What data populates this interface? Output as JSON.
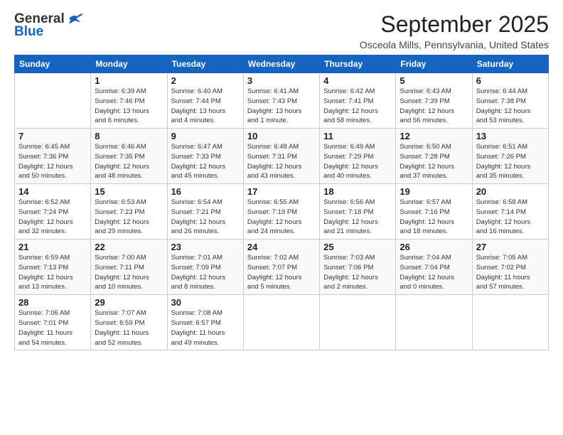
{
  "logo": {
    "line1": "General",
    "line2": "Blue"
  },
  "header": {
    "month": "September 2025",
    "location": "Osceola Mills, Pennsylvania, United States"
  },
  "weekdays": [
    "Sunday",
    "Monday",
    "Tuesday",
    "Wednesday",
    "Thursday",
    "Friday",
    "Saturday"
  ],
  "weeks": [
    [
      {
        "day": "",
        "info": ""
      },
      {
        "day": "1",
        "info": "Sunrise: 6:39 AM\nSunset: 7:46 PM\nDaylight: 13 hours\nand 6 minutes."
      },
      {
        "day": "2",
        "info": "Sunrise: 6:40 AM\nSunset: 7:44 PM\nDaylight: 13 hours\nand 4 minutes."
      },
      {
        "day": "3",
        "info": "Sunrise: 6:41 AM\nSunset: 7:43 PM\nDaylight: 13 hours\nand 1 minute."
      },
      {
        "day": "4",
        "info": "Sunrise: 6:42 AM\nSunset: 7:41 PM\nDaylight: 12 hours\nand 58 minutes."
      },
      {
        "day": "5",
        "info": "Sunrise: 6:43 AM\nSunset: 7:39 PM\nDaylight: 12 hours\nand 56 minutes."
      },
      {
        "day": "6",
        "info": "Sunrise: 6:44 AM\nSunset: 7:38 PM\nDaylight: 12 hours\nand 53 minutes."
      }
    ],
    [
      {
        "day": "7",
        "info": "Sunrise: 6:45 AM\nSunset: 7:36 PM\nDaylight: 12 hours\nand 50 minutes."
      },
      {
        "day": "8",
        "info": "Sunrise: 6:46 AM\nSunset: 7:35 PM\nDaylight: 12 hours\nand 48 minutes."
      },
      {
        "day": "9",
        "info": "Sunrise: 6:47 AM\nSunset: 7:33 PM\nDaylight: 12 hours\nand 45 minutes."
      },
      {
        "day": "10",
        "info": "Sunrise: 6:48 AM\nSunset: 7:31 PM\nDaylight: 12 hours\nand 43 minutes."
      },
      {
        "day": "11",
        "info": "Sunrise: 6:49 AM\nSunset: 7:29 PM\nDaylight: 12 hours\nand 40 minutes."
      },
      {
        "day": "12",
        "info": "Sunrise: 6:50 AM\nSunset: 7:28 PM\nDaylight: 12 hours\nand 37 minutes."
      },
      {
        "day": "13",
        "info": "Sunrise: 6:51 AM\nSunset: 7:26 PM\nDaylight: 12 hours\nand 35 minutes."
      }
    ],
    [
      {
        "day": "14",
        "info": "Sunrise: 6:52 AM\nSunset: 7:24 PM\nDaylight: 12 hours\nand 32 minutes."
      },
      {
        "day": "15",
        "info": "Sunrise: 6:53 AM\nSunset: 7:23 PM\nDaylight: 12 hours\nand 29 minutes."
      },
      {
        "day": "16",
        "info": "Sunrise: 6:54 AM\nSunset: 7:21 PM\nDaylight: 12 hours\nand 26 minutes."
      },
      {
        "day": "17",
        "info": "Sunrise: 6:55 AM\nSunset: 7:19 PM\nDaylight: 12 hours\nand 24 minutes."
      },
      {
        "day": "18",
        "info": "Sunrise: 6:56 AM\nSunset: 7:18 PM\nDaylight: 12 hours\nand 21 minutes."
      },
      {
        "day": "19",
        "info": "Sunrise: 6:57 AM\nSunset: 7:16 PM\nDaylight: 12 hours\nand 18 minutes."
      },
      {
        "day": "20",
        "info": "Sunrise: 6:58 AM\nSunset: 7:14 PM\nDaylight: 12 hours\nand 16 minutes."
      }
    ],
    [
      {
        "day": "21",
        "info": "Sunrise: 6:59 AM\nSunset: 7:13 PM\nDaylight: 12 hours\nand 13 minutes."
      },
      {
        "day": "22",
        "info": "Sunrise: 7:00 AM\nSunset: 7:11 PM\nDaylight: 12 hours\nand 10 minutes."
      },
      {
        "day": "23",
        "info": "Sunrise: 7:01 AM\nSunset: 7:09 PM\nDaylight: 12 hours\nand 8 minutes."
      },
      {
        "day": "24",
        "info": "Sunrise: 7:02 AM\nSunset: 7:07 PM\nDaylight: 12 hours\nand 5 minutes."
      },
      {
        "day": "25",
        "info": "Sunrise: 7:03 AM\nSunset: 7:06 PM\nDaylight: 12 hours\nand 2 minutes."
      },
      {
        "day": "26",
        "info": "Sunrise: 7:04 AM\nSunset: 7:04 PM\nDaylight: 12 hours\nand 0 minutes."
      },
      {
        "day": "27",
        "info": "Sunrise: 7:05 AM\nSunset: 7:02 PM\nDaylight: 11 hours\nand 57 minutes."
      }
    ],
    [
      {
        "day": "28",
        "info": "Sunrise: 7:06 AM\nSunset: 7:01 PM\nDaylight: 11 hours\nand 54 minutes."
      },
      {
        "day": "29",
        "info": "Sunrise: 7:07 AM\nSunset: 6:59 PM\nDaylight: 11 hours\nand 52 minutes."
      },
      {
        "day": "30",
        "info": "Sunrise: 7:08 AM\nSunset: 6:57 PM\nDaylight: 11 hours\nand 49 minutes."
      },
      {
        "day": "",
        "info": ""
      },
      {
        "day": "",
        "info": ""
      },
      {
        "day": "",
        "info": ""
      },
      {
        "day": "",
        "info": ""
      }
    ]
  ]
}
